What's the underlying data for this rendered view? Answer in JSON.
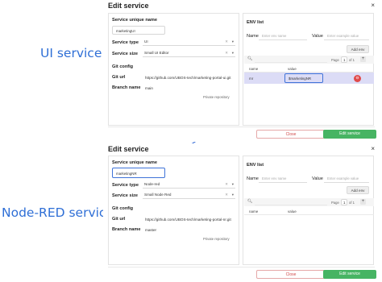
{
  "labels": {
    "ui_service": "UI service >",
    "nodered_service": "Node-RED service >"
  },
  "ui_dialog": {
    "title": "Edit service",
    "close": "×",
    "service_unique_name_label": "Service unique name",
    "service_unique_name_value": "marketingUI",
    "service_type_label": "Service type",
    "service_type_value": "UI",
    "service_size_label": "Service size",
    "service_size_value": "Small UI Editor",
    "git_config_label": "Git config",
    "git_url_label": "Git url",
    "git_url_value": "https://github.com/UBOS-tech/marketing-portal-ui.git",
    "branch_name_label": "Branch name",
    "branch_name_value": "main",
    "private_repo": "Private repository",
    "env": {
      "title": "ENV list",
      "name_label": "Name",
      "name_placeholder": "Enter env name",
      "value_label": "Value",
      "value_placeholder": "Enter example value",
      "add_env": "Add env",
      "page": "Page",
      "page_number": "1",
      "page_total": "of 1",
      "col_name": "name",
      "col_value": "value",
      "rows": [
        {
          "name": "mr",
          "value": "$marketingNR"
        }
      ]
    },
    "close_btn": "Close",
    "edit_btn": "Edit service"
  },
  "nr_dialog": {
    "title": "Edit service",
    "close": "×",
    "service_unique_name_label": "Service unique name",
    "service_unique_name_value": "marketingNR",
    "service_type_label": "Service type",
    "service_type_value": "Node-red",
    "service_size_label": "Service size",
    "service_size_value": "Small Node Red",
    "git_config_label": "Git config",
    "git_url_label": "Git url",
    "git_url_value": "https://github.com/UBOS-tech/marketing-portal-nr.git",
    "branch_name_label": "Branch name",
    "branch_name_value": "master",
    "private_repo": "Private repository",
    "env": {
      "title": "ENV list",
      "name_label": "Name",
      "name_placeholder": "Enter env name",
      "value_label": "Value",
      "value_placeholder": "Enter example value",
      "add_env": "Add env",
      "page": "Page",
      "page_number": "1",
      "page_total": "of 1",
      "col_name": "name",
      "col_value": "value"
    },
    "close_btn": "Close",
    "edit_btn": "Edit service"
  },
  "colors": {
    "accent": "#3f73d8",
    "label_blue": "#2f6fd6",
    "edit_green": "#47b463",
    "close_red": "#d04a4a",
    "row_highlight": "#dcdcf6"
  }
}
